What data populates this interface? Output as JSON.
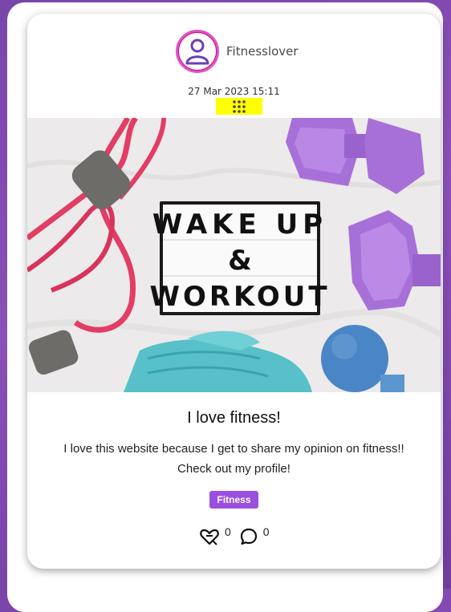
{
  "post": {
    "username": "Fitnesslover",
    "timestamp": "27 Mar 2023 15:11",
    "image": {
      "sign_line1": "WAKE UP",
      "sign_line2": "&",
      "sign_line3": "WORKOUT"
    },
    "title": "I love fitness!",
    "body": "I love this website because I get to share my opinion on fitness!! Check out my profile!",
    "tag": "Fitness",
    "likes": "0",
    "comments": "0"
  },
  "colors": {
    "background": "#7a45a8",
    "tag": "#9b4fe0",
    "avatar_ring": "#e6007e",
    "highlight": "#ffff00"
  },
  "icons": [
    "user-icon",
    "drag-handle-icon",
    "heart-like-icon",
    "comment-icon"
  ]
}
